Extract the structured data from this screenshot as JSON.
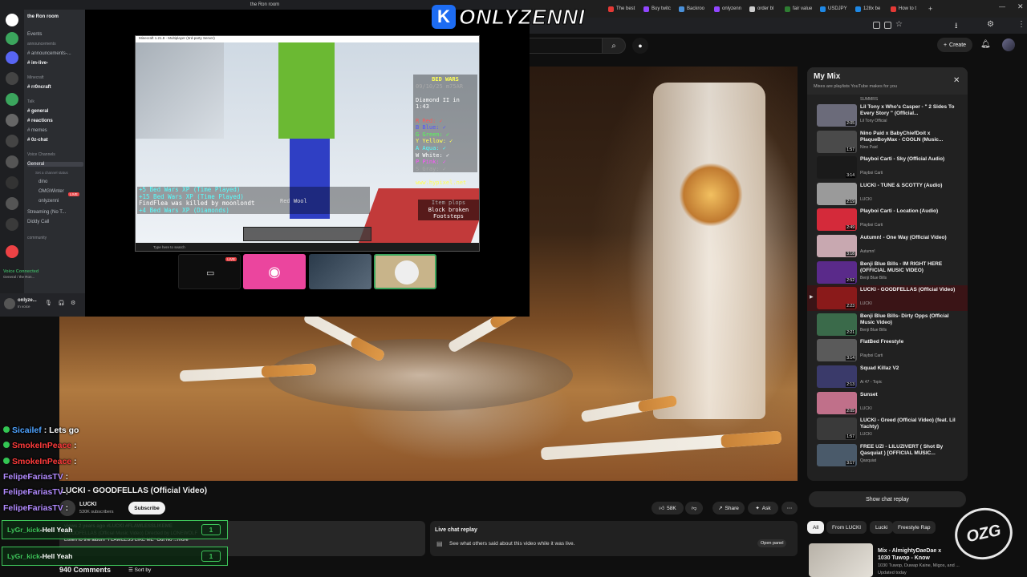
{
  "browser": {
    "tabs": [
      {
        "label": "The best",
        "color": "#e53935"
      },
      {
        "label": "Buy twitc",
        "color": "#9146ff"
      },
      {
        "label": "Backroo",
        "color": "#4a90d9"
      },
      {
        "label": "onlyzenn",
        "color": "#9146ff"
      },
      {
        "label": "order bl",
        "color": "#cccccc"
      },
      {
        "label": "fair value",
        "color": "#2e7d32"
      },
      {
        "label": "USDJPY",
        "color": "#1e88e5"
      },
      {
        "label": "128x be",
        "color": "#1e88e5"
      },
      {
        "label": "How to t",
        "color": "#e53935"
      }
    ]
  },
  "youtube": {
    "create_label": "Create",
    "video_title": "LUCKI - GOODFELLAS (Official Video)",
    "channel_name": "LUCKI",
    "subscribers": "530K subscribers",
    "subscribe_label": "Subscribe",
    "likes": "58K",
    "share_label": "Share",
    "ask_label": "Ask",
    "description": {
      "meta": "views  2 years ago  #LUCKI #FLAWLESSLIKEME",
      "line1": "GOODFELLAS (Official Music Video) Directed by LONEWOLF",
      "line2": "Listen to the album \"FLAWLESS LIKE ME\" Out No    ...more"
    },
    "comments_count": "940 Comments",
    "sort_label": "Sort by",
    "live_chat": {
      "title": "Live chat replay",
      "text": "See what others said about this video while it was live.",
      "open_label": "Open panel"
    },
    "show_chat_label": "Show chat replay",
    "chips": [
      "All",
      "From LUCKI",
      "Lucki",
      "Freestyle Rap"
    ],
    "recommended": {
      "title": "Mix - AlmightyDaeDae x 1030 Tuwop - Know",
      "subtitle": "1030 Tuwop, Duwap Kaine, Migos, and ...",
      "meta": "Updated today"
    }
  },
  "mymix": {
    "title": "My Mix",
    "subtitle": "Mixes are playlists YouTube makes for you",
    "top_channel": "SUMMRS",
    "items": [
      {
        "title": "Lil Tony x Who's Casper - \" 2 Sides To Every Story \" (Official...",
        "channel": "Lil Tony Official",
        "duration": "2:05",
        "thumb": "#6b6b7a",
        "active": false
      },
      {
        "title": "Nino Paid x BabyChiefDoit x PlaqueBoyMax - COOLN (Music...",
        "channel": "Nino Paid",
        "duration": "1:57",
        "thumb": "#4a4a4a",
        "active": false
      },
      {
        "title": "Playboi Carti - Sky (Official Audio)",
        "channel": "Playboi Carti",
        "duration": "3:14",
        "thumb": "#1a1a1a",
        "active": false
      },
      {
        "title": "LUCKI - TUNE & SCOTTY (Audio)",
        "channel": "LUCKI",
        "duration": "2:19",
        "thumb": "#9a9a9a",
        "active": false
      },
      {
        "title": "Playboi Carti - Location (Audio)",
        "channel": "Playboi Carti",
        "duration": "2:49",
        "thumb": "#d42a3a",
        "active": false
      },
      {
        "title": "Autumn! - One Way (Official Video)",
        "channel": "Autumn!",
        "duration": "3:18",
        "thumb": "#c8a8b0",
        "active": false
      },
      {
        "title": "Benji Blue Bills - IM RIGHT HERE (OFFICIAL MUSIC VIDEO)",
        "channel": "Benji Blue Bills",
        "duration": "2:52",
        "thumb": "#5a2a8a",
        "active": false
      },
      {
        "title": "LUCKI - GOODFELLAS (Official Video)",
        "channel": "LUCKI",
        "duration": "2:23",
        "thumb": "#8a1a1a",
        "active": true
      },
      {
        "title": "Benji Blue Bills- Dirty Opps (Official Music Video)",
        "channel": "Benji Blue Bills",
        "duration": "2:21",
        "thumb": "#3a6a4a",
        "active": false
      },
      {
        "title": "FlatBed Freestyle",
        "channel": "Playboi Carti",
        "duration": "3:14",
        "thumb": "#5a5a5a",
        "active": false
      },
      {
        "title": "Squad Killaz V2",
        "channel": "Ai 47 - Topic",
        "duration": "2:13",
        "thumb": "#3a3a6a",
        "active": false
      },
      {
        "title": "Sunset",
        "channel": "LUCKI",
        "duration": "2:05",
        "thumb": "#c0708a",
        "active": false
      },
      {
        "title": "LUCKI - Greed (Official Video) (feat. Lil Yachty)",
        "channel": "LUCKI",
        "duration": "1:57",
        "thumb": "#3a3a3a",
        "active": false
      },
      {
        "title": "FREE UZI - LILUZIVERT ( Shot By Qasquiat ) [OFFICIAL MUSIC...",
        "channel": "Qasquiat",
        "duration": "3:17",
        "thumb": "#4a5a6a",
        "active": false
      }
    ]
  },
  "discord": {
    "window_title": "the Ron room",
    "server_name": "the Ron room",
    "events_label": "Events",
    "channels": [
      {
        "label": "announcements",
        "kind": "category"
      },
      {
        "label": "# announcements-...",
        "kind": "channel"
      },
      {
        "label": "# im-live-",
        "kind": "channel"
      },
      {
        "label": "Minecraft",
        "kind": "category"
      },
      {
        "label": "# rr0ncraft",
        "kind": "channel"
      },
      {
        "label": "Talk",
        "kind": "category"
      },
      {
        "label": "# general",
        "kind": "channel"
      },
      {
        "label": "# reactions",
        "kind": "channel"
      },
      {
        "label": "# memes",
        "kind": "channel"
      },
      {
        "label": "# 0z-chat",
        "kind": "channel"
      },
      {
        "label": "Voice Channels",
        "kind": "category"
      },
      {
        "label": "General",
        "kind": "voice"
      },
      {
        "label": "Set a channel status",
        "kind": "status"
      },
      {
        "label": "dino",
        "kind": "member"
      },
      {
        "label": "OMGWinter",
        "kind": "member"
      },
      {
        "label": "onlyzenni",
        "kind": "member"
      },
      {
        "label": "Streaming (No T...",
        "kind": "voice"
      },
      {
        "label": "Diddy Call",
        "kind": "voice"
      },
      {
        "label": "community",
        "kind": "category"
      }
    ],
    "live_badge": "LIVE",
    "voice_status": "Voice Connected",
    "voice_sub": "General / the Ron...",
    "username": "onlyze...",
    "user_status": "In voice"
  },
  "minecraft": {
    "title_bar": "Minecraft 1.21.8 - Multiplayer (3rd-party Server)",
    "scoreboard": [
      "BED WARS",
      "09/10/25  m75AR",
      "",
      "Diamond II in 1:43",
      "",
      "R Red: ✓",
      "B Blue: ✓",
      "G Green: ✓",
      "Y Yellow: ✓",
      "A Aqua: ✓",
      "W White: ✓",
      "P Pink: ✓",
      "S Gray: ✓",
      "",
      "www.hypixel.net"
    ],
    "chat": [
      "+5 Bed Wars XP (Time Played)",
      "+15 Bed Wars XP (Time Played)",
      "FindFlea was killed by moonlondt",
      "+4 Bed Wars XP (Diamonds)"
    ],
    "held_item": "Red Wool",
    "tooltip": [
      "Item plops",
      "Block broken",
      "Footsteps"
    ],
    "search_placeholder": "Type here to search"
  },
  "stream_chat": [
    {
      "user": "Sicailef",
      "message": "Lets go",
      "color": "#4fa3ff",
      "dot": true
    },
    {
      "user": "SmokeInPeace",
      "message": "",
      "color": "#ff3b3b",
      "dot": true
    },
    {
      "user": "SmokeInPeace",
      "message": "",
      "color": "#ff3b3b",
      "dot": true
    },
    {
      "user": "FelipeFariasTV",
      "message": "",
      "color": "#b28bff",
      "dot": false
    },
    {
      "user": "FelipeFariasTV",
      "message": "",
      "color": "#b28bff",
      "dot": false
    },
    {
      "user": "FelipeFariasTV",
      "message": "",
      "color": "#b28bff",
      "dot": false
    }
  ],
  "highlight_chat": [
    {
      "user": "LyGr_kick",
      "message": "Hell Yeah",
      "badge": "1"
    },
    {
      "user": "LyGr_kick",
      "message": "Hell Yeah",
      "badge": "1"
    }
  ],
  "overlay": {
    "brand": "ONLYZENNI",
    "brand_letter": "K",
    "corner_logo": "OZG"
  }
}
